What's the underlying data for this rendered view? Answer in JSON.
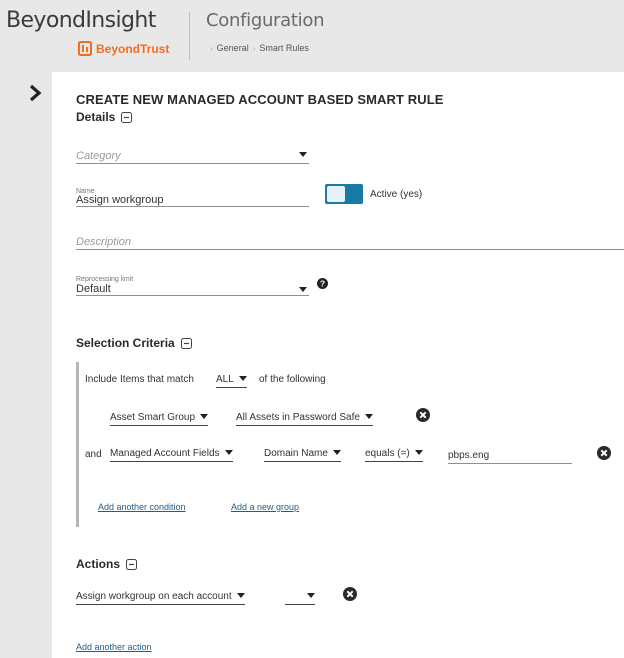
{
  "header": {
    "brand": "BeyondInsight",
    "vendor": "BeyondTrust",
    "page_title": "Configuration",
    "breadcrumb": [
      "General",
      "Smart Rules"
    ]
  },
  "rail": {
    "expand_icon": "chevron-right-icon"
  },
  "form": {
    "title": "CREATE NEW MANAGED ACCOUNT BASED SMART RULE",
    "details": {
      "heading": "Details",
      "category_placeholder": "Category",
      "name_label": "Name",
      "name_value": "Assign workgroup",
      "active_label": "Active (yes)",
      "description_placeholder": "Description",
      "reprocessing_label": "Reprocessing limit",
      "reprocessing_value": "Default"
    },
    "selection": {
      "heading": "Selection Criteria",
      "include_prefix": "Include Items that match",
      "match_value": "ALL",
      "include_suffix": "of the following",
      "condition1": {
        "field": "Asset Smart Group",
        "value": "All Assets in Password Safe"
      },
      "condition2": {
        "conjunction": "and",
        "field": "Managed Account Fields",
        "subfield": "Domain Name",
        "operator": "equals (=)",
        "value": "pbps.eng"
      },
      "add_condition": "Add another condition",
      "add_group": "Add a new group"
    },
    "actions": {
      "heading": "Actions",
      "action1": "Assign workgroup on each account",
      "action1_target": "",
      "add_action": "Add another action"
    }
  },
  "colors": {
    "accent": "#1a7aa6",
    "brand_orange": "#f26e21",
    "link": "#1a5f8e",
    "header_bg": "#e8e8e8"
  }
}
